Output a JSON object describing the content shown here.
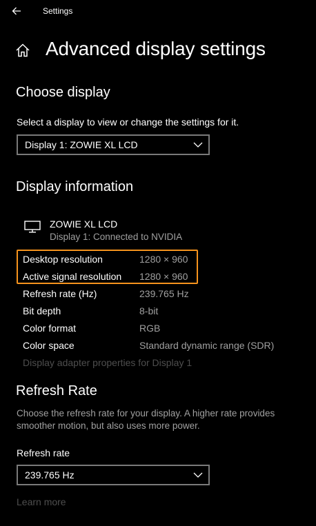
{
  "titlebar": {
    "back_icon": "back-arrow-icon",
    "title": "Settings"
  },
  "header": {
    "home_icon": "home-icon",
    "title": "Advanced display settings"
  },
  "choose_display": {
    "heading": "Choose display",
    "description": "Select a display to view or change the settings for it.",
    "selected": "Display 1: ZOWIE XL LCD"
  },
  "display_info": {
    "heading": "Display information",
    "monitor_icon": "monitor-icon",
    "monitor_name": "ZOWIE XL LCD",
    "monitor_subtitle": "Display 1: Connected to NVIDIA",
    "rows": [
      {
        "label": "Desktop resolution",
        "value": "1280 × 960"
      },
      {
        "label": "Active signal resolution",
        "value": "1280 × 960"
      },
      {
        "label": "Refresh rate (Hz)",
        "value": "239.765 Hz"
      },
      {
        "label": "Bit depth",
        "value": "8-bit"
      },
      {
        "label": "Color format",
        "value": "RGB"
      },
      {
        "label": "Color space",
        "value": "Standard dynamic range (SDR)"
      }
    ],
    "adapter_link": "Display adapter properties for Display 1",
    "highlight_color": "#f7941d"
  },
  "refresh_rate": {
    "heading": "Refresh Rate",
    "description_line1": "Choose the refresh rate for your display. A higher rate provides",
    "description_line2": "smoother motion, but also uses more power.",
    "field_label": "Refresh rate",
    "selected": "239.765 Hz",
    "learn_more": "Learn more"
  }
}
